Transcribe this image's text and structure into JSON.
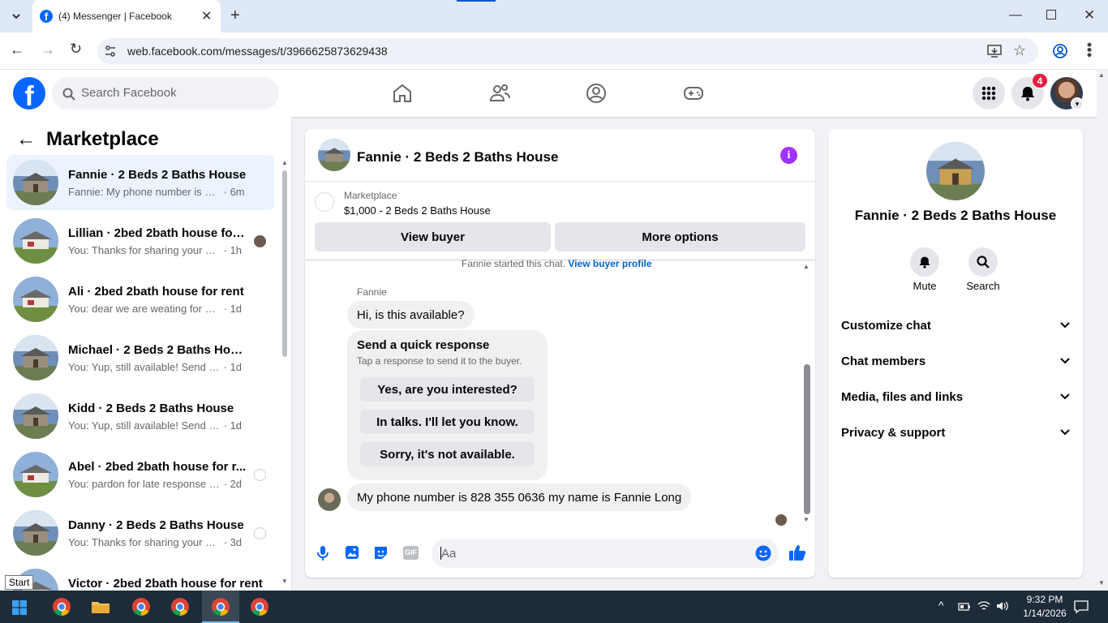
{
  "browser": {
    "tab_title": "(4) Messenger | Facebook",
    "url": "web.facebook.com/messages/t/3966625873629438"
  },
  "header": {
    "search_placeholder": "Search Facebook",
    "notification_count": "4"
  },
  "sidebar": {
    "title": "Marketplace",
    "conversations": [
      {
        "name": "Fannie · 2 Beds 2 Baths House",
        "preview": "Fannie: My phone number is 828 3...",
        "time": "6m",
        "active": true
      },
      {
        "name": "Lillian · 2bed 2bath house for ...",
        "preview": "You: Thanks for sharing your nu...",
        "time": "1h"
      },
      {
        "name": "Ali · 2bed 2bath house for rent",
        "preview": "You: dear we are weating for your r...",
        "time": "1d"
      },
      {
        "name": "Michael · 2 Beds 2 Baths House",
        "preview": "You: Yup, still available! Send over y...",
        "time": "1d"
      },
      {
        "name": "Kidd · 2 Beds 2 Baths House",
        "preview": "You: Yup, still available! Send over y...",
        "time": "1d"
      },
      {
        "name": "Abel · 2bed 2bath house for r...",
        "preview": "You: pardon for late response ar...",
        "time": "2d"
      },
      {
        "name": "Danny · 2 Beds 2 Baths House",
        "preview": "You: Thanks for sharing your nu...",
        "time": "3d"
      },
      {
        "name": "Victor · 2bed 2bath house for rent",
        "preview": "",
        "time": ""
      }
    ]
  },
  "chat": {
    "title": "Fannie · 2 Beds 2 Baths House",
    "listing_source": "Marketplace",
    "listing": "$1,000 - 2 Beds 2 Baths House",
    "view_buyer": "View buyer",
    "more_options": "More options",
    "started_text": "Fannie started this chat.",
    "view_profile": "View buyer profile",
    "sender": "Fannie",
    "msg1": "Hi, is this available?",
    "quick_title": "Send a quick response",
    "quick_sub": "Tap a response to send it to the buyer.",
    "quick_responses": [
      "Yes, are you interested?",
      "In talks. I'll let you know.",
      "Sorry, it's not available."
    ],
    "msg2": "My phone number is 828 355 0636 my name is Fannie Long",
    "composer_placeholder": "Aa",
    "gif_label": "GIF"
  },
  "details": {
    "name": "Fannie · 2 Beds 2 Baths House",
    "mute": "Mute",
    "search": "Search",
    "sections": [
      "Customize chat",
      "Chat members",
      "Media, files and links",
      "Privacy & support"
    ]
  },
  "taskbar": {
    "start_tooltip": "Start",
    "time": "9:32 PM",
    "date": "1/14/2026"
  },
  "colors": {
    "fb_blue": "#0866ff",
    "messenger_purple": "#a033ff",
    "notification_red": "#e41e3f"
  }
}
